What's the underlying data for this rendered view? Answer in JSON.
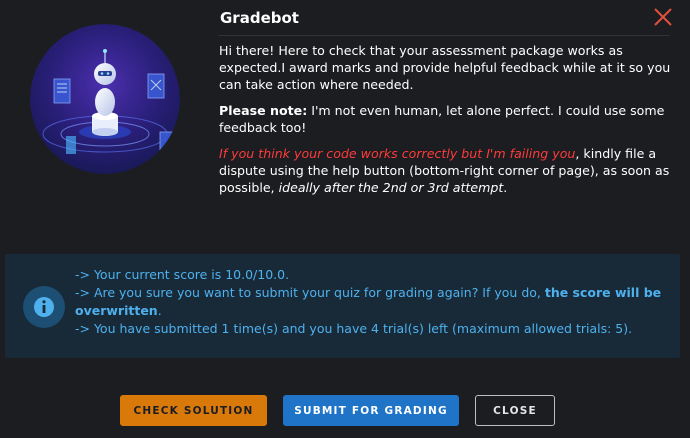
{
  "dialog": {
    "title": "Gradebot",
    "intro_1": "Hi there! Here to check that your assessment package works as expected.I award marks and provide helpful feedback while at it so you can take action where needed.",
    "note_bold": "Please note:",
    "note_rest": " I'm not even human, let alone perfect. I could use some feedback too!",
    "dispute_red": "If you think your code works correctly but I'm failing you",
    "dispute_mid": ", kindly file a dispute using the help button (bottom-right corner of page), as soon as possible, ",
    "dispute_italic": "ideally after the 2nd or 3rd attempt",
    "dispute_end": "."
  },
  "info": {
    "line1": "-> Your current score is 10.0/10.0.",
    "line2_pre": "->  Are you sure you want to submit your quiz for grading again? If you do, ",
    "line2_bold": "the score will be overwritten",
    "line2_end": ".",
    "line3": "-> You have submitted 1 time(s) and you have 4 trial(s) left (maximum allowed trials: 5)."
  },
  "buttons": {
    "check": "CHECK SOLUTION",
    "submit": "SUBMIT FOR GRADING",
    "close": "CLOSE"
  },
  "icons": {
    "close": "close-icon",
    "info": "info-icon",
    "robot": "robot-illustration"
  },
  "colors": {
    "background": "#1b1d21",
    "accent_orange": "#d9790a",
    "accent_blue": "#1f74c7",
    "info_text": "#4eb1ee",
    "warning_red": "#ff3b3b",
    "close_x": "#e0503a"
  }
}
